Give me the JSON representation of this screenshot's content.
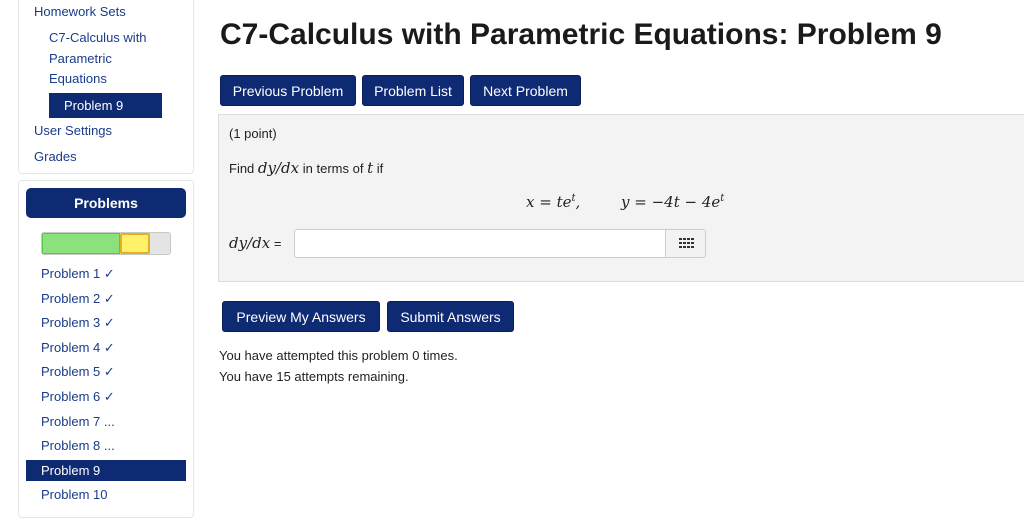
{
  "nav": {
    "homework_sets": "Homework Sets",
    "course": "C7-Calculus with Parametric Equations",
    "current_problem": "Problem 9",
    "user_settings": "User Settings",
    "grades": "Grades"
  },
  "problems_panel": {
    "header": "Problems",
    "progress": {
      "correct_fraction": 0.6,
      "incorrect_fraction": 0.1
    },
    "items": [
      {
        "label": "Problem 1 ✓"
      },
      {
        "label": "Problem 2 ✓"
      },
      {
        "label": "Problem 3 ✓"
      },
      {
        "label": "Problem 4 ✓"
      },
      {
        "label": "Problem 5 ✓"
      },
      {
        "label": "Problem 6 ✓"
      },
      {
        "label": "Problem 7 ..."
      },
      {
        "label": "Problem 8 ..."
      },
      {
        "label": "Problem 9"
      },
      {
        "label": "Problem 10"
      }
    ]
  },
  "main": {
    "title": "C7-Calculus with Parametric Equations: Problem 9",
    "buttons": {
      "previous": "Previous Problem",
      "list": "Problem List",
      "next": "Next Problem"
    },
    "problem": {
      "points": "(1 point)",
      "prompt_prefix": "Find",
      "prompt_math": "dy/dx",
      "prompt_middle": "in terms of",
      "prompt_var": "t",
      "prompt_suffix": "if",
      "eq_x": "x = te",
      "eq_x_sup": "t",
      "eq_x_tail": ",",
      "eq_y": "y = −4t − 4e",
      "eq_y_sup": "t",
      "answer_label": "dy/dx",
      "answer_eq": " =",
      "answer_value": ""
    },
    "actions": {
      "preview": "Preview My Answers",
      "submit": "Submit Answers"
    },
    "attempts_line1": "You have attempted this problem 0 times.",
    "attempts_line2": "You have 15 attempts remaining."
  },
  "colors": {
    "primary": "#0e2a73",
    "link": "#1a3c8c",
    "correct": "#8be27c",
    "incorrect": "#fff16a"
  }
}
